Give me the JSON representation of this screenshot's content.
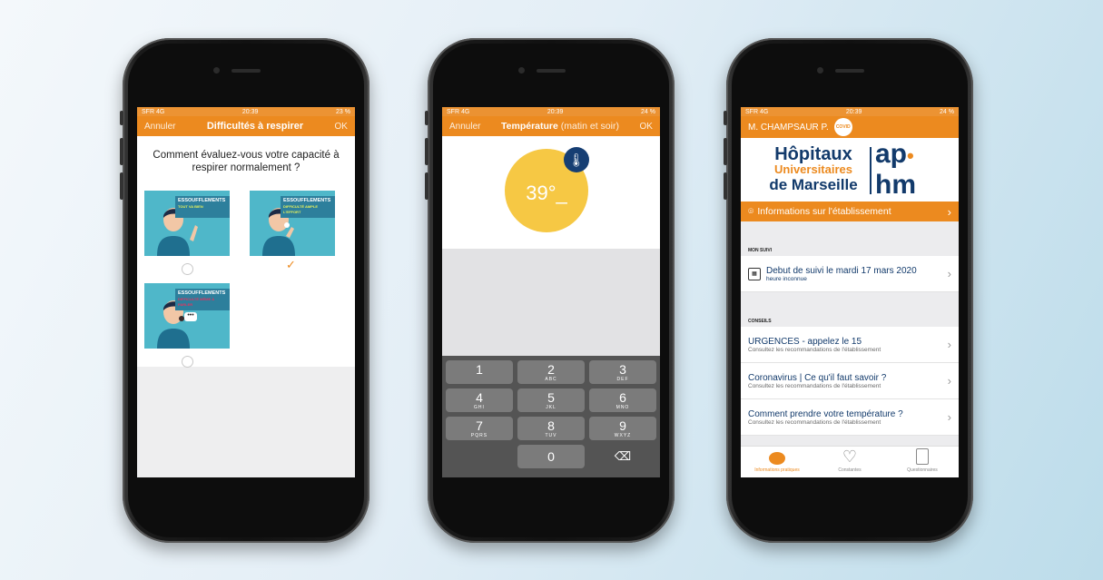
{
  "colors": {
    "accent": "#ec8a1f",
    "navy": "#123a6b",
    "teal": "#4fb7c9",
    "yellow": "#f6c844"
  },
  "phone1": {
    "status": {
      "carrier": "SFR 4G",
      "time": "20:39",
      "battery": "23 %"
    },
    "nav": {
      "cancel": "Annuler",
      "title": "Difficultés à respirer",
      "ok": "OK"
    },
    "question": "Comment évaluez-vous votre capacité à respirer normalement ?",
    "options": [
      {
        "title": "ESSOUFFLEMENTS",
        "subtitle": "TOUT VA BIEN",
        "selected": false
      },
      {
        "title": "ESSOUFFLEMENTS",
        "subtitle": "DIFFICULTÉ AMPLE L'EFFORT",
        "selected": true
      },
      {
        "title": "ESSOUFFLEMENTS",
        "subtitle": "DIFFICULTÉ MÊME À PARLER",
        "selected": false
      }
    ]
  },
  "phone2": {
    "status": {
      "carrier": "SFR 4G",
      "time": "20:39",
      "battery": "24 %"
    },
    "nav": {
      "cancel": "Annuler",
      "title": "Température",
      "title_suffix": "(matin et soir)",
      "ok": "OK"
    },
    "temperature": "39°_",
    "keys": [
      {
        "n": "1",
        "l": ""
      },
      {
        "n": "2",
        "l": "ABC"
      },
      {
        "n": "3",
        "l": "DEF"
      },
      {
        "n": "4",
        "l": "GHI"
      },
      {
        "n": "5",
        "l": "JKL"
      },
      {
        "n": "6",
        "l": "MNO"
      },
      {
        "n": "7",
        "l": "PQRS"
      },
      {
        "n": "8",
        "l": "TUV"
      },
      {
        "n": "9",
        "l": "WXYZ"
      },
      {
        "n": "0",
        "l": ""
      }
    ]
  },
  "phone3": {
    "status": {
      "carrier": "SFR 4G",
      "time": "20:39",
      "battery": "24 %"
    },
    "user_name": "M. CHAMPSAUR P.",
    "badge": "COVID",
    "logo": {
      "line1": "Hôpitaux",
      "line2": "Universitaires",
      "line3": "de Marseille",
      "ap": "ap",
      "hm": "hm"
    },
    "info_bar": "Informations sur l'établissement",
    "section_suivi": "MON SUIVI",
    "suivi_main": "Debut de suivi le mardi 17 mars 2020",
    "suivi_sub": "heure inconnue",
    "section_conseils": "CONSEILS",
    "conseils": [
      {
        "main": "URGENCES - appelez le 15",
        "sub": "Consultez les recommandations de l'établissement"
      },
      {
        "main": "Coronavirus | Ce qu'il faut savoir ?",
        "sub": "Consultez les recommandations de l'établissement"
      },
      {
        "main": "Comment prendre votre température ?",
        "sub": "Consultez les recommandations de l'établissement"
      }
    ],
    "tabs": [
      {
        "label": "Informations pratiques",
        "active": true
      },
      {
        "label": "Constantes",
        "active": false
      },
      {
        "label": "Questionnaires",
        "active": false
      }
    ]
  }
}
